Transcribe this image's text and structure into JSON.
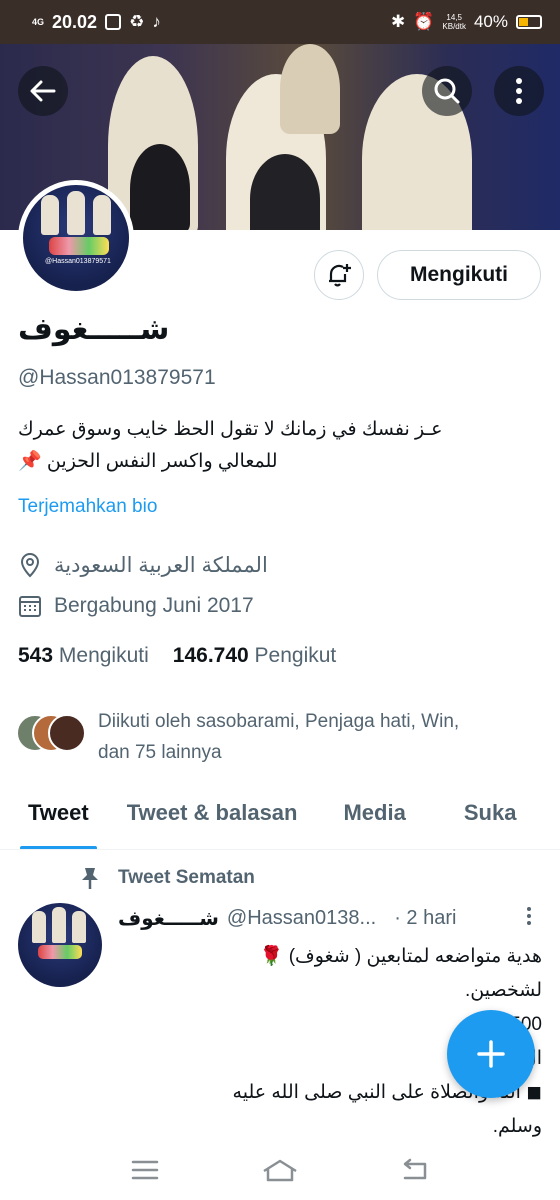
{
  "status_bar": {
    "network": "4G",
    "time": "20.02",
    "speed": "14,5\nKB/dtk",
    "battery": "40%"
  },
  "profile": {
    "name": "شـــــغوف",
    "handle": "@Hassan013879571",
    "bio_line1": "عـز نفسك في زمانك لا تقول الحظ خايب وسوق عمرك",
    "bio_line2": "للمعالي واكسر النفس الحزين 📌",
    "translate_label": "Terjemahkan bio",
    "location": "المملكة العربية السعودية",
    "joined": "Bergabung Juni 2017",
    "avatar_caption": "@Hassan013879571"
  },
  "actions": {
    "follow_label": "Mengikuti"
  },
  "stats": {
    "following_count": "543",
    "following_label": "Mengikuti",
    "followers_count": "146.740",
    "followers_label": "Pengikut"
  },
  "followed_by": {
    "line1": "Diikuti oleh sasobarami, Penjaga hati, Win,",
    "line2": "dan 75 lainnya"
  },
  "tabs": [
    {
      "label": "Tweet",
      "active": true
    },
    {
      "label": "Tweet & balasan",
      "active": false
    },
    {
      "label": "Media",
      "active": false
    },
    {
      "label": "Suka",
      "active": false
    }
  ],
  "pinned_tweet": {
    "pinned_label": "Tweet Sematan",
    "name": "شـــــغوف",
    "handle": "@Hassan0138...",
    "time": "· 2 hari",
    "line1": "هدية متواضعه لمتابعين ( شغوف) 🌹",
    "line2": "لشخصين.",
    "line3": "1500﷼",
    "line4": "ال",
    "line5": "◼ الله والصلاة على النبي صلى الله عليه",
    "line6": "وسلم."
  },
  "colors": {
    "accent": "#1d9bf0",
    "status_bar_bg": "#3a2e28",
    "secondary_text": "#536471"
  }
}
